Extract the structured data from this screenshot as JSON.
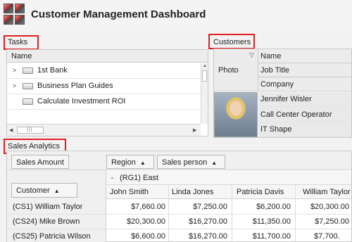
{
  "app": {
    "title": "Customer Management Dashboard"
  },
  "tasks": {
    "section_label": "Tasks",
    "column_header": "Name",
    "items": [
      {
        "label": "1st Bank",
        "expandable": true
      },
      {
        "label": "Business Plan Guides",
        "expandable": true
      },
      {
        "label": "Calculate Investment ROI",
        "expandable": false
      }
    ]
  },
  "customers": {
    "section_label": "Customers",
    "photo_header": "Photo",
    "fields": [
      "Name",
      "Job Title",
      "Company"
    ],
    "record": {
      "name": "Jennifer Wisler",
      "job_title": "Call Center Operator",
      "company": "IT Shape"
    }
  },
  "analytics": {
    "section_label": "Sales Analytics",
    "data_field": "Sales Amount",
    "column_fields": [
      "Region",
      "Sales person"
    ],
    "row_field": "Customer",
    "group_label": "(RG1) East",
    "columns": [
      "John Smith",
      "Linda Jones",
      "Patricia Davis",
      "William Taylor"
    ],
    "rows": [
      {
        "customer": "(CS1) William Taylor",
        "values": [
          "$7,660.00",
          "$7,250.00",
          "$6,200.00",
          "$20,300.00"
        ]
      },
      {
        "customer": "(CS24) Mike Brown",
        "values": [
          "$20,300.00",
          "$16,270.00",
          "$11,350.00",
          "$7,250.00"
        ]
      },
      {
        "customer": "(CS25) Patricia Wilson",
        "values": [
          "$6,600.00",
          "$16,270.00",
          "$11,700.00",
          "$7,700."
        ]
      }
    ]
  },
  "colors": {
    "highlight_box": "#e02020",
    "background": "#f2f2f2"
  }
}
